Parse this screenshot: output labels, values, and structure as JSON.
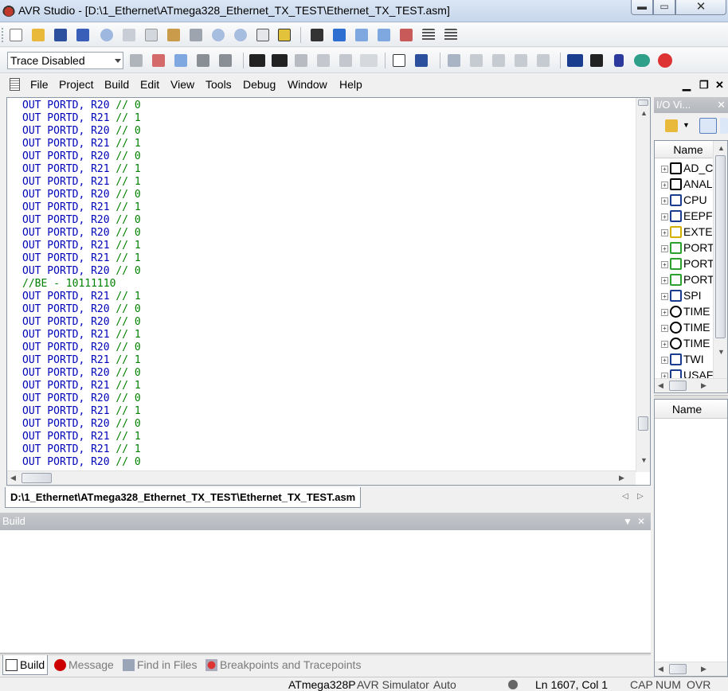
{
  "window": {
    "title": "AVR Studio - [D:\\1_Ethernet\\ATmega328_Ethernet_TX_TEST\\Ethernet_TX_TEST.asm]",
    "minimize": "▬",
    "maximize": "▭",
    "close": "✕"
  },
  "toolbar2": {
    "trace_mode": "Trace Disabled"
  },
  "menu": {
    "items": [
      "File",
      "Project",
      "Build",
      "Edit",
      "View",
      "Tools",
      "Debug",
      "Window",
      "Help"
    ],
    "mdi_minimize": "▁",
    "mdi_restore": "❐",
    "mdi_close": "✕"
  },
  "editor": {
    "lines": [
      {
        "code": "OUT PORTD, R20",
        "comment": "// 0"
      },
      {
        "code": "OUT PORTD, R21",
        "comment": "// 1"
      },
      {
        "code": "OUT PORTD, R20",
        "comment": "// 0"
      },
      {
        "code": "OUT PORTD, R21",
        "comment": "// 1"
      },
      {
        "code": "OUT PORTD, R20",
        "comment": "// 0"
      },
      {
        "code": "OUT PORTD, R21",
        "comment": "// 1"
      },
      {
        "code": "OUT PORTD, R21",
        "comment": "// 1"
      },
      {
        "code": "OUT PORTD, R20",
        "comment": "// 0"
      },
      {
        "code": "OUT PORTD, R21",
        "comment": "// 1"
      },
      {
        "code": "OUT PORTD, R20",
        "comment": "// 0"
      },
      {
        "code": "OUT PORTD, R20",
        "comment": "// 0"
      },
      {
        "code": "OUT PORTD, R21",
        "comment": "// 1"
      },
      {
        "code": "OUT PORTD, R21",
        "comment": "// 1"
      },
      {
        "code": "OUT PORTD, R20",
        "comment": "// 0"
      },
      {
        "code": "",
        "comment": "//BE - 10111110"
      },
      {
        "code": "OUT PORTD, R21",
        "comment": "// 1"
      },
      {
        "code": "OUT PORTD, R20",
        "comment": "// 0"
      },
      {
        "code": "OUT PORTD, R20",
        "comment": "// 0"
      },
      {
        "code": "OUT PORTD, R21",
        "comment": "// 1"
      },
      {
        "code": "OUT PORTD, R20",
        "comment": "// 0"
      },
      {
        "code": "OUT PORTD, R21",
        "comment": "// 1"
      },
      {
        "code": "OUT PORTD, R20",
        "comment": "// 0"
      },
      {
        "code": "OUT PORTD, R21",
        "comment": "// 1"
      },
      {
        "code": "OUT PORTD, R20",
        "comment": "// 0"
      },
      {
        "code": "OUT PORTD, R21",
        "comment": "// 1"
      },
      {
        "code": "OUT PORTD, R20",
        "comment": "// 0"
      },
      {
        "code": "OUT PORTD, R21",
        "comment": "// 1"
      },
      {
        "code": "OUT PORTD, R21",
        "comment": "// 1"
      },
      {
        "code": "OUT PORTD, R20",
        "comment": "// 0"
      }
    ]
  },
  "doc_tab": {
    "label": "D:\\1_Ethernet\\ATmega328_Ethernet_TX_TEST\\Ethernet_TX_TEST.asm"
  },
  "build_panel": {
    "title": "Build"
  },
  "bottom_tabs": [
    "Build",
    "Message",
    "Find in Files",
    "Breakpoints and Tracepoints"
  ],
  "io_view": {
    "title": "I/O Vi...",
    "column_name": "Name",
    "items": [
      {
        "label": "AD_C",
        "icon": "analog-icon",
        "color": "#000000"
      },
      {
        "label": "ANAL",
        "icon": "analog-icon",
        "color": "#000000"
      },
      {
        "label": "CPU",
        "icon": "cpu-icon",
        "color": "#1a3d8f"
      },
      {
        "label": "EEPF",
        "icon": "eeprom-icon",
        "color": "#1a3d8f"
      },
      {
        "label": "EXTE",
        "icon": "external-interrupt-icon",
        "color": "#d4b000"
      },
      {
        "label": "PORT",
        "icon": "port-icon",
        "color": "#2ea02e"
      },
      {
        "label": "PORT",
        "icon": "port-icon",
        "color": "#2ea02e"
      },
      {
        "label": "PORT",
        "icon": "port-icon",
        "color": "#2ea02e"
      },
      {
        "label": "SPI",
        "icon": "spi-icon",
        "color": "#1a3d8f"
      },
      {
        "label": "TIME",
        "icon": "timer-icon",
        "color": "#000000"
      },
      {
        "label": "TIME",
        "icon": "timer-icon",
        "color": "#000000"
      },
      {
        "label": "TIME",
        "icon": "timer-icon",
        "color": "#000000"
      },
      {
        "label": "TWI",
        "icon": "twi-icon",
        "color": "#1a3d8f"
      },
      {
        "label": "USAF",
        "icon": "usart-icon",
        "color": "#1a3d8f"
      }
    ],
    "properties_column": "Name"
  },
  "status": {
    "device": "ATmega328P",
    "platform": "AVR Simulator",
    "mode": "Auto",
    "position": "Ln 1607, Col 1",
    "caps": "CAP",
    "num": "NUM",
    "ovr": "OVR"
  },
  "colors": {
    "keyword": "#0000b8",
    "comment": "#008000",
    "panel_header": "#b9bcc1"
  }
}
